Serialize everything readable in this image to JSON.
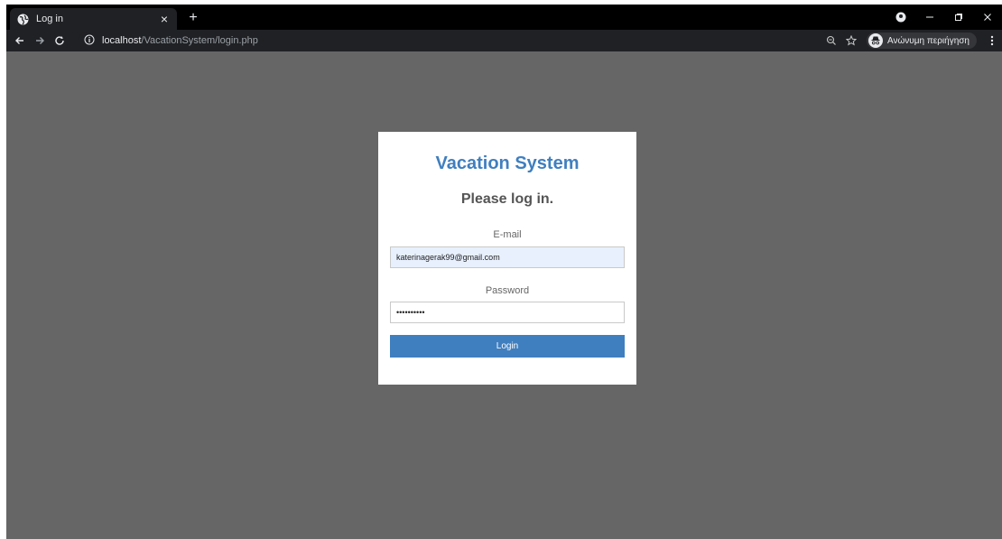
{
  "browser": {
    "tab_title": "Log in",
    "tab_close": "×",
    "new_tab": "+",
    "url_host": "localhost",
    "url_path": "/VacationSystem/login.php",
    "incognito_label": "Ανώνυμη περιήγηση",
    "icons": {
      "back": "arrow-left-icon",
      "forward": "arrow-right-icon",
      "reload": "reload-icon",
      "info": "info-icon",
      "zoom": "zoom-icon",
      "star": "star-icon",
      "menu": "kebab-menu-icon"
    }
  },
  "login": {
    "app_title": "Vacation System",
    "subtitle": "Please log in.",
    "email_label": "E-mail",
    "email_value": "katerinagerak99@gmail.com",
    "password_label": "Password",
    "password_value": "••••••••••",
    "login_button": "Login"
  },
  "colors": {
    "accent": "#3f7fbf",
    "page_bg": "#666666",
    "autofill_bg": "#e8f0fe"
  }
}
